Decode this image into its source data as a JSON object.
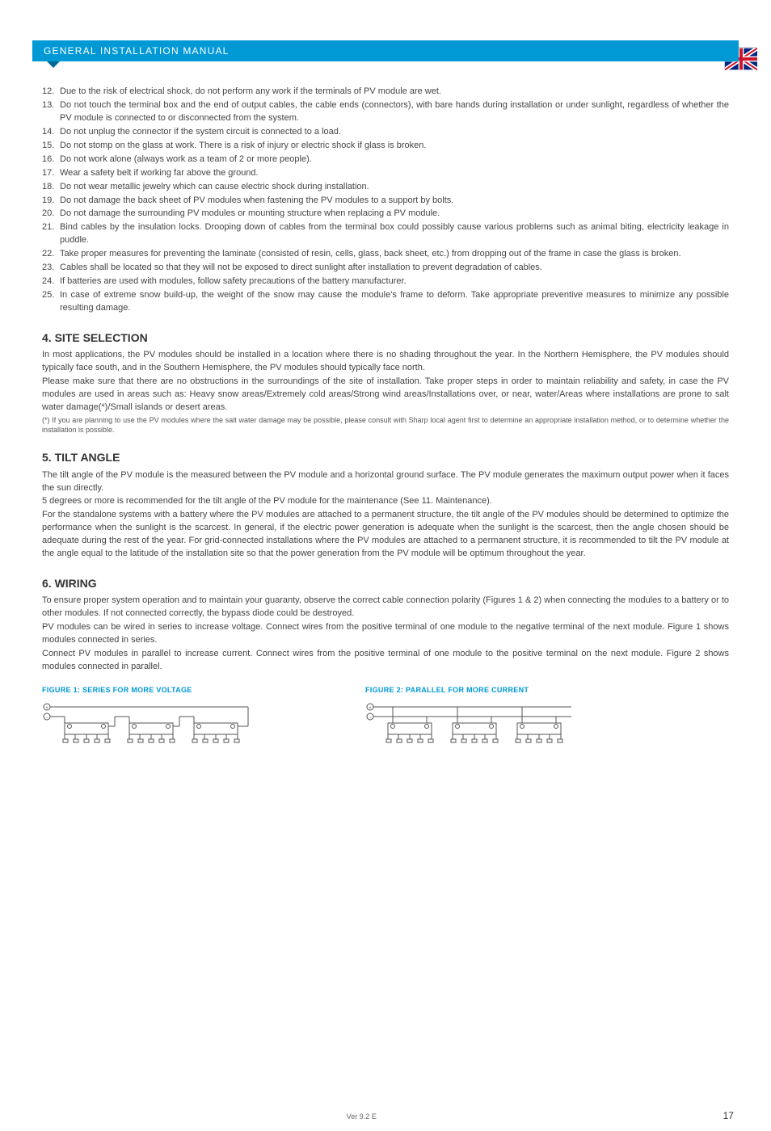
{
  "header": {
    "title": "GENERAL INSTALLATION MANUAL"
  },
  "list": [
    {
      "n": "12.",
      "t": "Due to the risk of electrical shock, do not perform any work if the terminals of PV module are wet."
    },
    {
      "n": "13.",
      "t": "Do not touch the terminal box and the end of output cables, the cable ends (connectors), with bare hands during installation or under sunlight, regardless of whether the PV module is connected to or disconnected from the system."
    },
    {
      "n": "14.",
      "t": "Do not unplug the connector if the system circuit is connected to a load."
    },
    {
      "n": "15.",
      "t": "Do not stomp on the glass at work. There is a risk of injury or electric shock if glass is broken."
    },
    {
      "n": "16.",
      "t": "Do not work alone (always work as a team of 2 or more people)."
    },
    {
      "n": "17.",
      "t": "Wear a safety belt if working far above the ground."
    },
    {
      "n": "18.",
      "t": "Do not wear metallic jewelry which can cause electric shock during installation."
    },
    {
      "n": "19.",
      "t": "Do not damage the back sheet of PV modules when fastening the PV modules to a support by bolts."
    },
    {
      "n": "20.",
      "t": "Do not damage the surrounding PV modules or mounting structure when replacing a PV module."
    },
    {
      "n": "21.",
      "t": "Bind cables by the insulation locks. Drooping down of cables from the terminal box could possibly cause various problems such as animal biting, electricity leakage in puddle."
    },
    {
      "n": "22.",
      "t": "Take proper measures for preventing the laminate (consisted of resin, cells, glass, back sheet, etc.) from dropping out of the frame in case the glass is broken."
    },
    {
      "n": "23.",
      "t": "Cables shall be located so that they will not be exposed to direct sunlight after installation to prevent degradation of cables."
    },
    {
      "n": "24.",
      "t": "If batteries are used with modules, follow safety precautions of the battery manufacturer."
    },
    {
      "n": "25.",
      "t": "In case of extreme snow build-up, the weight of the snow may cause the module's frame to deform. Take appropriate preventive measures to minimize any possible resulting damage."
    }
  ],
  "sections": {
    "site": {
      "title": "4. SITE SELECTION",
      "p1": "In most applications, the PV modules should be installed in a location where there is no shading throughout the year. In the Northern Hemisphere, the PV modules should typically face south, and in the Southern Hemisphere, the PV modules should typically face north.",
      "p2": "Please make sure that there are no obstructions in the surroundings of the site of installation. Take proper steps in order to maintain reliability and safety, in case the PV modules are used in areas such as: Heavy snow areas/Extremely cold areas/Strong wind areas/Installations over, or near, water/Areas where installations are prone to salt water damage(*)/Small islands or desert areas.",
      "note": "(*) If you are planning to use the PV modules where the salt water damage may be possible, please consult with Sharp local agent first to determine an appropriate installation method, or to determine whether the installation is possible."
    },
    "tilt": {
      "title": "5. TILT ANGLE",
      "p1": "The tilt angle of the PV module is the measured between the PV module and a horizontal ground surface. The PV module generates the maximum output power when it faces the sun directly.",
      "p2": "5 degrees or more is recommended for the tilt angle of the PV module for the maintenance (See 11. Maintenance).",
      "p3": "For the standalone systems with a battery where the PV modules are attached to a permanent structure, the tilt angle of the PV modules should be determined to optimize the performance when the sunlight is the scarcest. In general, if the electric power generation is adequate when the sunlight is the scarcest, then the angle chosen should be adequate during the rest of the year. For grid-connected installations where the PV modules are attached to a permanent structure, it is recommended to tilt the PV module at the angle equal to the latitude of the installation site so that the power generation from the PV module will be optimum throughout the year."
    },
    "wiring": {
      "title": "6. WIRING",
      "p1": "To ensure proper system operation and to maintain your guaranty, observe the correct cable connection polarity (Figures 1 & 2) when connecting the modules to a battery or to other modules. If not connected correctly, the bypass diode could be destroyed.",
      "p2": "PV modules can be wired in series to increase voltage. Connect wires from the positive terminal of one module to the negative terminal of the next module. Figure 1 shows modules connected in series.",
      "p3": "Connect PV modules in parallel to increase current. Connect wires from the positive terminal of one module to the positive terminal on the next module. Figure 2 shows modules connected in parallel."
    }
  },
  "figures": {
    "fig1_title": "FIGURE 1: SERIES FOR MORE VOLTAGE",
    "fig2_title": "FIGURE 2: PARALLEL FOR MORE CURRENT"
  },
  "footer": {
    "ver": "Ver 9.2 E",
    "page": "17"
  }
}
